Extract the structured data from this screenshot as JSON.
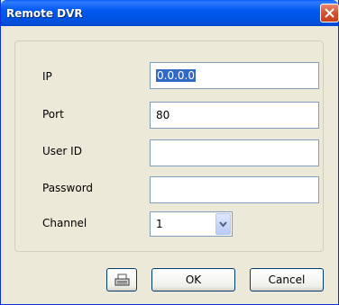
{
  "window": {
    "title": "Remote DVR"
  },
  "form": {
    "ip_label": "IP",
    "ip_value": "0.0.0.0",
    "port_label": "Port",
    "port_value": "80",
    "userid_label": "User ID",
    "userid_value": "",
    "password_label": "Password",
    "password_value": "",
    "channel_label": "Channel",
    "channel_value": "1"
  },
  "buttons": {
    "ok": "OK",
    "cancel": "Cancel"
  },
  "icons": {
    "close": "close-icon",
    "keyboard": "keyboard-icon",
    "dropdown": "chevron-down-icon"
  },
  "colors": {
    "title_bar": "#0054e3",
    "dialog_bg": "#ece9d8",
    "close_button": "#d4522c",
    "selection": "#316ac5"
  }
}
